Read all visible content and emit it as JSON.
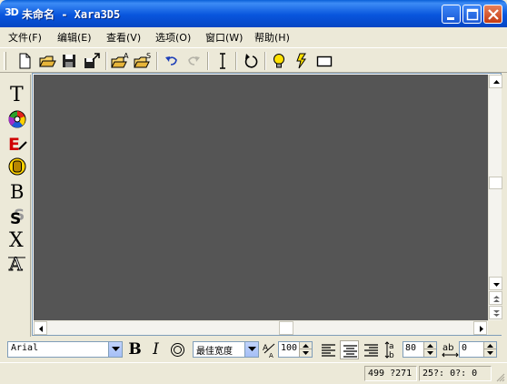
{
  "window": {
    "icon_text": "3D",
    "title": "未命名 - Xara3D5",
    "controls": [
      "minimize-icon",
      "maximize-icon",
      "close-icon"
    ]
  },
  "menu": {
    "items": [
      {
        "label": "文件(F)"
      },
      {
        "label": "编辑(E)"
      },
      {
        "label": "查看(V)"
      },
      {
        "label": "选项(O)"
      },
      {
        "label": "窗口(W)"
      },
      {
        "label": "帮助(H)"
      }
    ]
  },
  "toolbar": {
    "tools": [
      {
        "name": "new-file-icon"
      },
      {
        "name": "open-folder-icon"
      },
      {
        "name": "save-icon"
      },
      {
        "name": "export-icon"
      },
      {
        "name": "open-animation-icon"
      },
      {
        "name": "open-style-icon"
      },
      {
        "name": "undo-icon"
      },
      {
        "name": "redo-icon"
      },
      {
        "name": "text-cursor-icon"
      },
      {
        "name": "rotate-icon"
      },
      {
        "name": "lightbulb-icon"
      },
      {
        "name": "lightning-icon"
      },
      {
        "name": "rectangle-icon"
      }
    ]
  },
  "left_palette": {
    "tools": [
      {
        "name": "text-tool-icon",
        "glyph": "T"
      },
      {
        "name": "color-wheel-icon"
      },
      {
        "name": "edit-text-icon",
        "glyph": "E"
      },
      {
        "name": "bevel-icon"
      },
      {
        "name": "bold-style-icon",
        "glyph": "B"
      },
      {
        "name": "shadow-icon",
        "glyph": "S"
      },
      {
        "name": "extrude-icon",
        "glyph": "X"
      },
      {
        "name": "outline-text-icon",
        "glyph": "A"
      }
    ]
  },
  "canvas": {
    "background": "#555555"
  },
  "format_bar": {
    "font_name": "Arial",
    "bold_label": "B",
    "italic_label": "I",
    "width_option": "最佳宽度",
    "size_value": "100",
    "line_spacing_value": "80",
    "char_spacing_value": "0"
  },
  "status": {
    "dimensions": "499 ?271",
    "timing": "25?: 0?: 0"
  },
  "colors": {
    "titlebar": "#0855dd",
    "chrome": "#ece9d8",
    "canvas": "#555555"
  }
}
